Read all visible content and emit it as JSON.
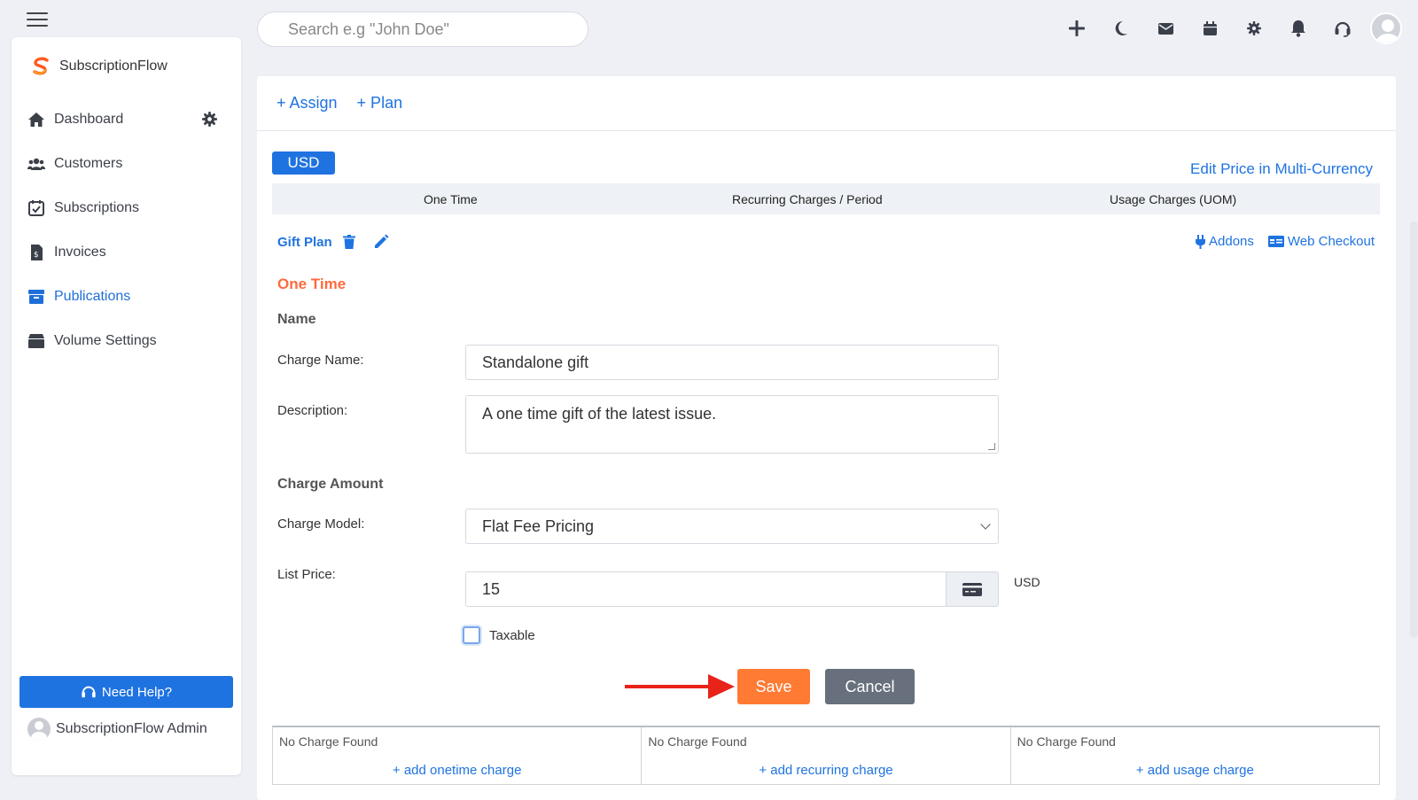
{
  "header": {
    "search_placeholder": "Search e.g \"John Doe\""
  },
  "sidebar": {
    "brand": "SubscriptionFlow",
    "items": [
      {
        "label": "Dashboard"
      },
      {
        "label": "Customers"
      },
      {
        "label": "Subscriptions"
      },
      {
        "label": "Invoices"
      },
      {
        "label": "Publications"
      },
      {
        "label": "Volume Settings"
      }
    ],
    "help_label": "Need Help?",
    "admin_name": "SubscriptionFlow Admin"
  },
  "main": {
    "head_links": [
      "+ Assign",
      "+ Plan"
    ],
    "currency_badge": "USD",
    "edit_multi_currency": "Edit Price in Multi-Currency",
    "columns": [
      "One Time",
      "Recurring Charges / Period",
      "Usage Charges (UOM)"
    ],
    "plan_name": "Gift Plan",
    "addons_label": "Addons",
    "web_checkout_label": "Web Checkout",
    "section_title": "One Time",
    "name_heading": "Name",
    "charge_name_label": "Charge Name:",
    "charge_name_value": "Standalone gift",
    "description_label": "Description:",
    "description_value": "A one time gift of the latest issue.",
    "charge_amount_heading": "Charge Amount",
    "charge_model_label": "Charge Model:",
    "charge_model_value": "Flat Fee Pricing",
    "list_price_label": "List Price:",
    "list_price_value": "15",
    "list_price_currency": "USD",
    "taxable_label": "Taxable",
    "save_label": "Save",
    "cancel_label": "Cancel",
    "charges": [
      {
        "empty": "No Charge Found",
        "add": "+ add onetime charge"
      },
      {
        "empty": "No Charge Found",
        "add": "+ add recurring charge"
      },
      {
        "empty": "No Charge Found",
        "add": "+ add usage charge"
      }
    ]
  },
  "colors": {
    "primary": "#1f73e0",
    "accent_orange": "#ff7a33",
    "section_orange": "#ff6a3d",
    "cancel_gray": "#67707c",
    "arrow_red": "#e8231a"
  }
}
